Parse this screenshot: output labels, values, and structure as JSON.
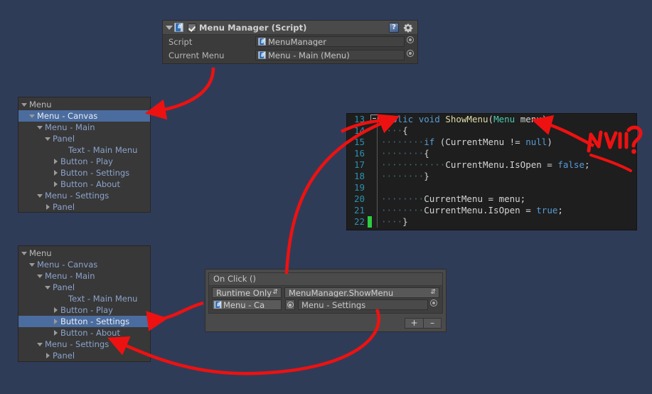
{
  "background_color": "#2f3c58",
  "accent_annotation_color": "#ee1111",
  "inspector": {
    "title": "Menu Manager (Script)",
    "enabled_checkbox": true,
    "foldout_expanded": true,
    "icons": {
      "foldout": "chevron-down-icon",
      "script": "csharp-script-icon",
      "help": "help-book-icon",
      "settings": "gear-icon"
    },
    "rows": [
      {
        "label": "Script",
        "value": "MenuManager",
        "has_icon": true
      },
      {
        "label": "Current Menu",
        "value": "Menu - Main (Menu)",
        "has_icon": true
      }
    ]
  },
  "hierarchy_top": {
    "rows": [
      {
        "label": "Menu",
        "indent": 0,
        "arrow": "down",
        "selected": false,
        "root": true
      },
      {
        "label": "Menu - Canvas",
        "indent": 1,
        "arrow": "down",
        "selected": true,
        "root": false
      },
      {
        "label": "Menu - Main",
        "indent": 2,
        "arrow": "down",
        "selected": false,
        "root": false
      },
      {
        "label": "Panel",
        "indent": 3,
        "arrow": "down",
        "selected": false,
        "root": false
      },
      {
        "label": "Text - Main Menu",
        "indent": 5,
        "arrow": "none",
        "selected": false,
        "root": false
      },
      {
        "label": "Button - Play",
        "indent": 4,
        "arrow": "right",
        "selected": false,
        "root": false
      },
      {
        "label": "Button - Settings",
        "indent": 4,
        "arrow": "right",
        "selected": false,
        "root": false
      },
      {
        "label": "Button - About",
        "indent": 4,
        "arrow": "right",
        "selected": false,
        "root": false
      },
      {
        "label": "Menu - Settings",
        "indent": 2,
        "arrow": "down",
        "selected": false,
        "root": false
      },
      {
        "label": "Panel",
        "indent": 3,
        "arrow": "right",
        "selected": false,
        "root": false
      }
    ]
  },
  "hierarchy_bottom": {
    "rows": [
      {
        "label": "Menu",
        "indent": 0,
        "arrow": "down",
        "selected": false,
        "root": true
      },
      {
        "label": "Menu - Canvas",
        "indent": 1,
        "arrow": "down",
        "selected": false,
        "root": false
      },
      {
        "label": "Menu - Main",
        "indent": 2,
        "arrow": "down",
        "selected": false,
        "root": false
      },
      {
        "label": "Panel",
        "indent": 3,
        "arrow": "down",
        "selected": false,
        "root": false
      },
      {
        "label": "Text - Main Menu",
        "indent": 5,
        "arrow": "none",
        "selected": false,
        "root": false
      },
      {
        "label": "Button - Play",
        "indent": 4,
        "arrow": "right",
        "selected": false,
        "root": false
      },
      {
        "label": "Button - Settings",
        "indent": 4,
        "arrow": "right",
        "selected": true,
        "root": false
      },
      {
        "label": "Button - About",
        "indent": 4,
        "arrow": "right",
        "selected": false,
        "root": false
      },
      {
        "label": "Menu - Settings",
        "indent": 2,
        "arrow": "down",
        "selected": false,
        "root": false
      },
      {
        "label": "Panel",
        "indent": 3,
        "arrow": "right",
        "selected": false,
        "root": false
      }
    ]
  },
  "code": {
    "language": "csharp",
    "first_line_number": 13,
    "lines": [
      {
        "num": "13",
        "marker": "",
        "vline": true,
        "indent_dots": "",
        "tokens": [
          {
            "t": "public",
            "c": "k"
          },
          {
            "t": " ",
            "c": "p"
          },
          {
            "t": "void",
            "c": "k"
          },
          {
            "t": " ",
            "c": "p"
          },
          {
            "t": "ShowMenu",
            "c": "m"
          },
          {
            "t": "(",
            "c": "p"
          },
          {
            "t": "Menu",
            "c": "t"
          },
          {
            "t": " menu)",
            "c": "p"
          }
        ]
      },
      {
        "num": "14",
        "marker": "",
        "vline": true,
        "indent_dots": "····",
        "tokens": [
          {
            "t": "{",
            "c": "p"
          }
        ]
      },
      {
        "num": "15",
        "marker": "",
        "vline": true,
        "indent_dots": "········",
        "tokens": [
          {
            "t": "if",
            "c": "k"
          },
          {
            "t": " (CurrentMenu != ",
            "c": "p"
          },
          {
            "t": "null",
            "c": "k"
          },
          {
            "t": ")",
            "c": "p"
          }
        ]
      },
      {
        "num": "16",
        "marker": "",
        "vline": true,
        "indent_dots": "········",
        "tokens": [
          {
            "t": "{",
            "c": "p"
          }
        ]
      },
      {
        "num": "17",
        "marker": "",
        "vline": true,
        "indent_dots": "············",
        "tokens": [
          {
            "t": "CurrentMenu.IsOpen = ",
            "c": "p"
          },
          {
            "t": "false",
            "c": "k"
          },
          {
            "t": ";",
            "c": "p"
          }
        ]
      },
      {
        "num": "18",
        "marker": "",
        "vline": true,
        "indent_dots": "········",
        "tokens": [
          {
            "t": "}",
            "c": "p"
          }
        ]
      },
      {
        "num": "19",
        "marker": "",
        "vline": true,
        "indent_dots": "",
        "tokens": [
          {
            "t": "",
            "c": "p"
          }
        ]
      },
      {
        "num": "20",
        "marker": "",
        "vline": true,
        "indent_dots": "········",
        "tokens": [
          {
            "t": "CurrentMenu = menu;",
            "c": "p"
          }
        ]
      },
      {
        "num": "21",
        "marker": "",
        "vline": true,
        "indent_dots": "········",
        "tokens": [
          {
            "t": "CurrentMenu.IsOpen = ",
            "c": "p"
          },
          {
            "t": "true",
            "c": "k"
          },
          {
            "t": ";",
            "c": "p"
          }
        ]
      },
      {
        "num": "22",
        "marker": "green",
        "vline": true,
        "indent_dots": "····",
        "tokens": [
          {
            "t": "}",
            "c": "p"
          }
        ]
      }
    ]
  },
  "on_click": {
    "title": "On Click ()",
    "entry": {
      "mode": "Runtime Only",
      "function": "MenuManager.ShowMenu",
      "target_object": "Menu - Ca",
      "argument": "Menu - Settings"
    },
    "buttons": {
      "add": "+",
      "remove": "–"
    }
  },
  "annotations": [
    {
      "name": "null-question-note",
      "text": "NULL?",
      "color": "#ee1111"
    }
  ]
}
